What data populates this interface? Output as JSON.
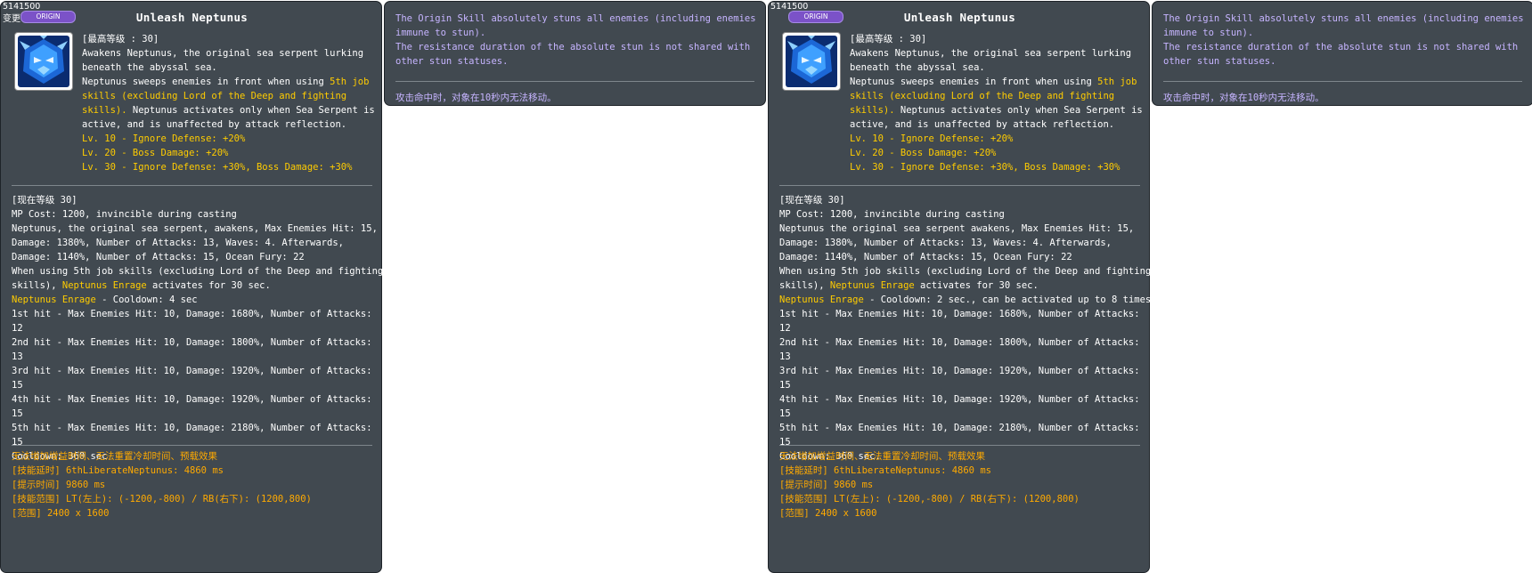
{
  "panels": [
    {
      "code": "5141500",
      "changed_label": "变更",
      "badge": "ORIGIN",
      "title": "Unleash Neptunus",
      "max_level": "[最高等级 : 30]",
      "desc": [
        {
          "t": "Awakens Neptunus, the original sea serpent lurking",
          "y": false
        },
        {
          "t": "beneath the abyssal sea.",
          "y": false
        },
        {
          "segs": [
            {
              "t": "Neptunus sweeps enemies in front when using ",
              "y": false
            },
            {
              "t": "5th job",
              "y": true
            }
          ]
        },
        {
          "t": "skills (excluding Lord of the Deep and fighting",
          "y": true
        },
        {
          "segs": [
            {
              "t": "skills).",
              "y": true
            },
            {
              "t": " Neptunus activates only when Sea Serpent is",
              "y": false
            }
          ]
        },
        {
          "t": "active, and is unaffected by attack reflection.",
          "y": false
        },
        {
          "t": " ",
          "y": false
        },
        {
          "t": "Lv. 10 - Ignore Defense: +20%",
          "y": true
        },
        {
          "t": "Lv. 20 - Boss Damage: +20%",
          "y": true
        },
        {
          "t": "Lv. 30 - Ignore Defense: +30%, Boss Damage: +30%",
          "y": true
        }
      ],
      "cur_level": "[现在等级 30]",
      "cur": [
        {
          "t": "MP Cost: 1200, invincible during casting"
        },
        {
          "t": "Neptunus, the original sea serpent, awakens, Max Enemies Hit: 15,"
        },
        {
          "t": "Damage: 1380%, Number of Attacks: 13, Waves: 4. Afterwards,"
        },
        {
          "t": "Damage: 1140%, Number of Attacks: 15, Ocean Fury: 22"
        },
        {
          "t": "When using 5th job skills (excluding Lord of the Deep and fighting"
        },
        {
          "segs": [
            {
              "t": "skills), ",
              "y": false
            },
            {
              "t": "Neptunus Enrage",
              "y": true
            },
            {
              "t": " activates for 30 sec.",
              "y": false
            }
          ]
        },
        {
          "segs": [
            {
              "t": "Neptunus Enrage",
              "y": true
            },
            {
              "t": " - Cooldown: 4 sec",
              "y": false
            }
          ]
        },
        {
          "t": "1st hit - Max Enemies Hit: 10, Damage: 1680%, Number of Attacks:"
        },
        {
          "t": "12"
        },
        {
          "t": "2nd hit - Max Enemies Hit: 10, Damage: 1800%, Number of Attacks:"
        },
        {
          "t": "13"
        },
        {
          "t": "3rd hit - Max Enemies Hit: 10, Damage: 1920%, Number of Attacks:"
        },
        {
          "t": "15"
        },
        {
          "t": "4th hit - Max Enemies Hit: 10, Damage: 1920%, Number of Attacks:"
        },
        {
          "t": "15"
        },
        {
          "t": "5th hit - Max Enemies Hit: 10, Damage: 2180%, Number of Attacks:"
        },
        {
          "t": "15"
        },
        {
          "t": "Cooldown: 360 sec"
        }
      ],
      "extra": [
        "无法增加增益时间、无法重置冷却时间、预载效果",
        "[技能延时] 6thLiberateNeptunus: 4860 ms",
        "[提示时间] 9860 ms",
        "[技能范围] LT(左上): (-1200,-800) / RB(右下): (1200,800)",
        "[范围] 2400 x 1600"
      ],
      "side": [
        "The Origin Skill absolutely stuns all enemies (including enemies",
        "immune to stun).",
        "The resistance duration of the absolute stun is not shared with",
        "other stun statuses."
      ],
      "side_cn": "攻击命中时，对象在10秒内无法移动。"
    },
    {
      "code": "5141500",
      "changed_label": "",
      "badge": "ORIGIN",
      "title": "Unleash Neptunus",
      "max_level": "[最高等级 : 30]",
      "desc": [
        {
          "t": "Awakens Neptunus, the original sea serpent lurking",
          "y": false
        },
        {
          "t": "beneath the abyssal sea.",
          "y": false
        },
        {
          "segs": [
            {
              "t": "Neptunus sweeps enemies in front when using ",
              "y": false
            },
            {
              "t": "5th job",
              "y": true
            }
          ]
        },
        {
          "t": "skills (excluding Lord of the Deep and fighting",
          "y": true
        },
        {
          "segs": [
            {
              "t": "skills).",
              "y": true
            },
            {
              "t": " Neptunus activates only when Sea Serpent is",
              "y": false
            }
          ]
        },
        {
          "t": "active, and is unaffected by attack reflection.",
          "y": false
        },
        {
          "t": " ",
          "y": false
        },
        {
          "t": "Lv. 10 - Ignore Defense: +20%",
          "y": true
        },
        {
          "t": "Lv. 20 - Boss Damage: +20%",
          "y": true
        },
        {
          "t": "Lv. 30 - Ignore Defense: +30%, Boss Damage: +30%",
          "y": true
        }
      ],
      "cur_level": "[现在等级 30]",
      "cur": [
        {
          "t": "MP Cost: 1200, invincible during casting"
        },
        {
          "t": "Neptunus the original sea serpent awakens, Max Enemies Hit: 15,"
        },
        {
          "t": "Damage: 1380%, Number of Attacks: 13, Waves: 4. Afterwards,"
        },
        {
          "t": "Damage: 1140%, Number of Attacks: 15, Ocean Fury: 22"
        },
        {
          "t": "When using 5th job skills (excluding Lord of the Deep and fighting"
        },
        {
          "segs": [
            {
              "t": "skills), ",
              "y": false
            },
            {
              "t": "Neptunus Enrage",
              "y": true
            },
            {
              "t": " activates for 30 sec.",
              "y": false
            }
          ]
        },
        {
          "segs": [
            {
              "t": "Neptunus Enrage",
              "y": true
            },
            {
              "t": " - Cooldown: 2 sec., can be activated up to 8 times",
              "y": false
            }
          ]
        },
        {
          "t": "1st hit - Max Enemies Hit: 10, Damage: 1680%, Number of Attacks:"
        },
        {
          "t": "12"
        },
        {
          "t": "2nd hit - Max Enemies Hit: 10, Damage: 1800%, Number of Attacks:"
        },
        {
          "t": "13"
        },
        {
          "t": "3rd hit - Max Enemies Hit: 10, Damage: 1920%, Number of Attacks:"
        },
        {
          "t": "15"
        },
        {
          "t": "4th hit - Max Enemies Hit: 10, Damage: 1920%, Number of Attacks:"
        },
        {
          "t": "15"
        },
        {
          "t": "5th hit - Max Enemies Hit: 10, Damage: 2180%, Number of Attacks:"
        },
        {
          "t": "15"
        },
        {
          "t": "Cooldown: 360 sec."
        }
      ],
      "extra": [
        "无法增加增益时间、无法重置冷却时间、预载效果",
        "[技能延时] 6thLiberateNeptunus: 4860 ms",
        "[提示时间] 9860 ms",
        "[技能范围] LT(左上): (-1200,-800) / RB(右下): (1200,800)",
        "[范围] 2400 x 1600"
      ],
      "side": [
        "The Origin Skill absolutely stuns all enemies (including enemies",
        "immune to stun).",
        "The resistance duration of the absolute stun is not shared with",
        "other stun statuses."
      ],
      "side_cn": "攻击命中时，对象在10秒内无法移动。"
    }
  ],
  "icon": "neptunus-skill-icon",
  "colors": {
    "panel": "#414950",
    "highlight": "#ffcc00",
    "extra": "#ffaa00",
    "side_text": "#c6b4ff",
    "badge": "#7b52c8"
  }
}
